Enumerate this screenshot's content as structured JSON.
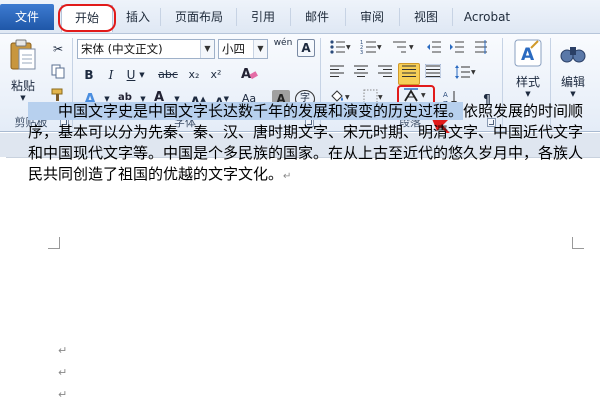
{
  "tabs": [
    {
      "id": "file",
      "label": "文件"
    },
    {
      "id": "home",
      "label": "开始"
    },
    {
      "id": "insert",
      "label": "插入"
    },
    {
      "id": "layout",
      "label": "页面布局"
    },
    {
      "id": "references",
      "label": "引用"
    },
    {
      "id": "mailings",
      "label": "邮件"
    },
    {
      "id": "review",
      "label": "审阅"
    },
    {
      "id": "view",
      "label": "视图"
    },
    {
      "id": "acrobat",
      "label": "Acrobat"
    }
  ],
  "ribbon": {
    "clipboard": {
      "label": "剪贴板",
      "paste_label": "粘贴"
    },
    "font": {
      "label": "字体",
      "font_name": "宋体 (中文正文)",
      "font_size": "小四",
      "bold": "B",
      "italic": "I",
      "underline": "U",
      "strike": "abc",
      "subscript": "x₂",
      "superscript": "x²",
      "grow": "A",
      "shrink": "A",
      "aa": "Aa",
      "clear_format": "A",
      "char_shading": "A",
      "enclose": "字",
      "wen": "wén"
    },
    "paragraph": {
      "label": "段落"
    },
    "styles": {
      "label": "样式"
    },
    "editing": {
      "label": "编辑"
    }
  },
  "colors": {
    "accent_file_tab": "#2b66bb",
    "annotation": "#e11a1a",
    "highlight": "#b7d0ee"
  },
  "document": {
    "highlighted": "中国文字史是中国文字长达数千年的发展和演变的历史过程。",
    "rest": "依照发展的时间顺序，基本可以分为先秦、秦、汉、唐时期文字、宋元时期、明清文字、中国近代文字和中国现代文字等。中国是个多民族的国家。在从上古至近代的悠久岁月中，各族人民共同创造了祖国的优越的文字文化。",
    "para_mark": "↵"
  }
}
